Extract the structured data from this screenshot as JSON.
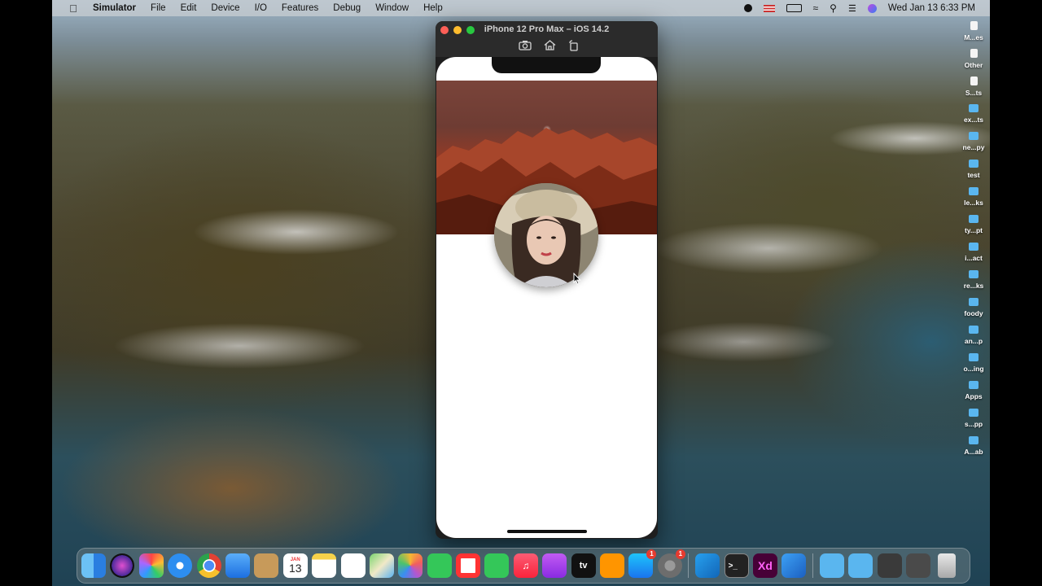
{
  "menubar": {
    "app_name": "Simulator",
    "items": [
      "File",
      "Edit",
      "Device",
      "I/O",
      "Features",
      "Debug",
      "Window",
      "Help"
    ],
    "datetime": "Wed Jan 13  6:33 PM"
  },
  "simulator": {
    "title": "iPhone 12 Pro Max – iOS 14.2",
    "toolbar": [
      "screenshot-icon",
      "home-icon",
      "rotate-icon"
    ]
  },
  "desktop_icons": [
    {
      "label": "M...es",
      "kind": "file"
    },
    {
      "label": "Other",
      "kind": "file"
    },
    {
      "label": "S...ts",
      "kind": "file"
    },
    {
      "label": "ex...ts",
      "kind": "folder"
    },
    {
      "label": "ne...py",
      "kind": "folder"
    },
    {
      "label": "test",
      "kind": "folder"
    },
    {
      "label": "le...ks",
      "kind": "folder"
    },
    {
      "label": "ty...pt",
      "kind": "folder"
    },
    {
      "label": "i...act",
      "kind": "folder"
    },
    {
      "label": "re...ks",
      "kind": "folder"
    },
    {
      "label": "foody",
      "kind": "folder"
    },
    {
      "label": "an...p",
      "kind": "folder"
    },
    {
      "label": "o...ing",
      "kind": "folder"
    },
    {
      "label": "Apps",
      "kind": "folder"
    },
    {
      "label": "s...pp",
      "kind": "folder"
    },
    {
      "label": "A...ab",
      "kind": "folder"
    }
  ],
  "dock": {
    "calendar_month": "JAN",
    "calendar_day": "13",
    "appletv_label": "tv",
    "xd_label": "Xd",
    "badges": {
      "appstore": "1",
      "settings": "1"
    }
  }
}
